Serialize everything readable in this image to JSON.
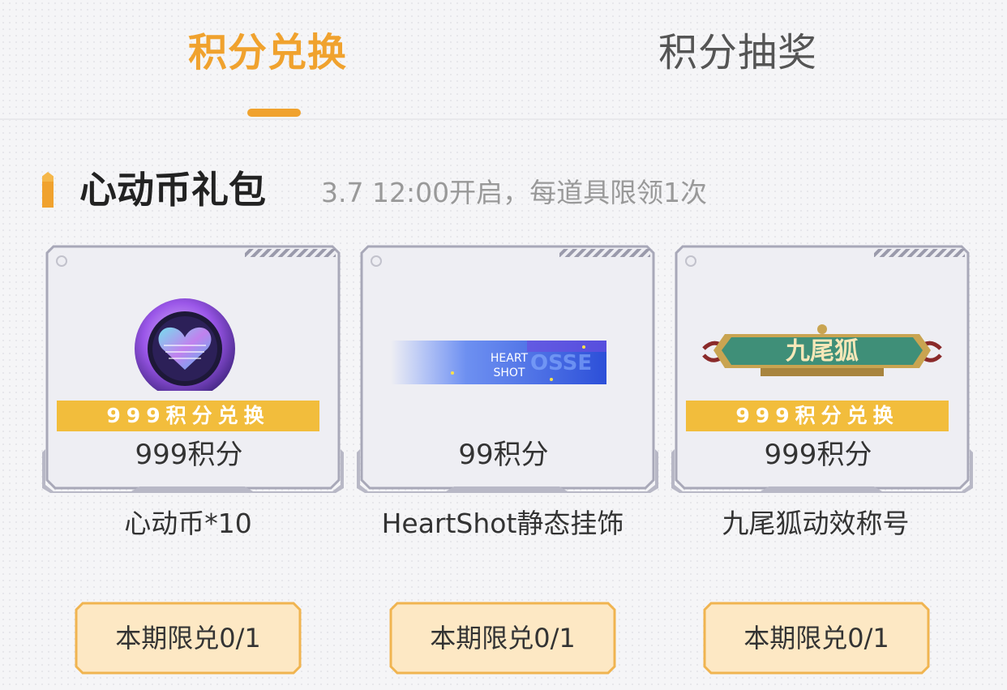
{
  "tabs": [
    {
      "label": "积分兑换",
      "active": true
    },
    {
      "label": "积分抽奖",
      "active": false
    }
  ],
  "section": {
    "title": "心动币礼包",
    "subtitle": "3.7 12:00开启，每道具限领1次"
  },
  "items": [
    {
      "badge": "999积分兑换",
      "price": "999积分",
      "name": "心动币*10",
      "limit": "本期限兑0/1",
      "icon": "heart-coin-icon"
    },
    {
      "badge": "",
      "price": "99积分",
      "name": "HeartShot静态挂饰",
      "limit": "本期限兑0/1",
      "icon": "heartshot-banner-image",
      "banner_text_1": "HEART",
      "banner_text_2": "SHOT"
    },
    {
      "badge": "999积分兑换",
      "price": "999积分",
      "name": "九尾狐动效称号",
      "limit": "本期限兑0/1",
      "icon": "nine-tail-fox-title-plaque",
      "plaque_text": "九尾狐"
    }
  ],
  "colors": {
    "accent": "#f0a22e",
    "badge": "#f2bd3c",
    "limit_button_bg": "#fde8c4",
    "limit_button_border": "#f0b450"
  }
}
